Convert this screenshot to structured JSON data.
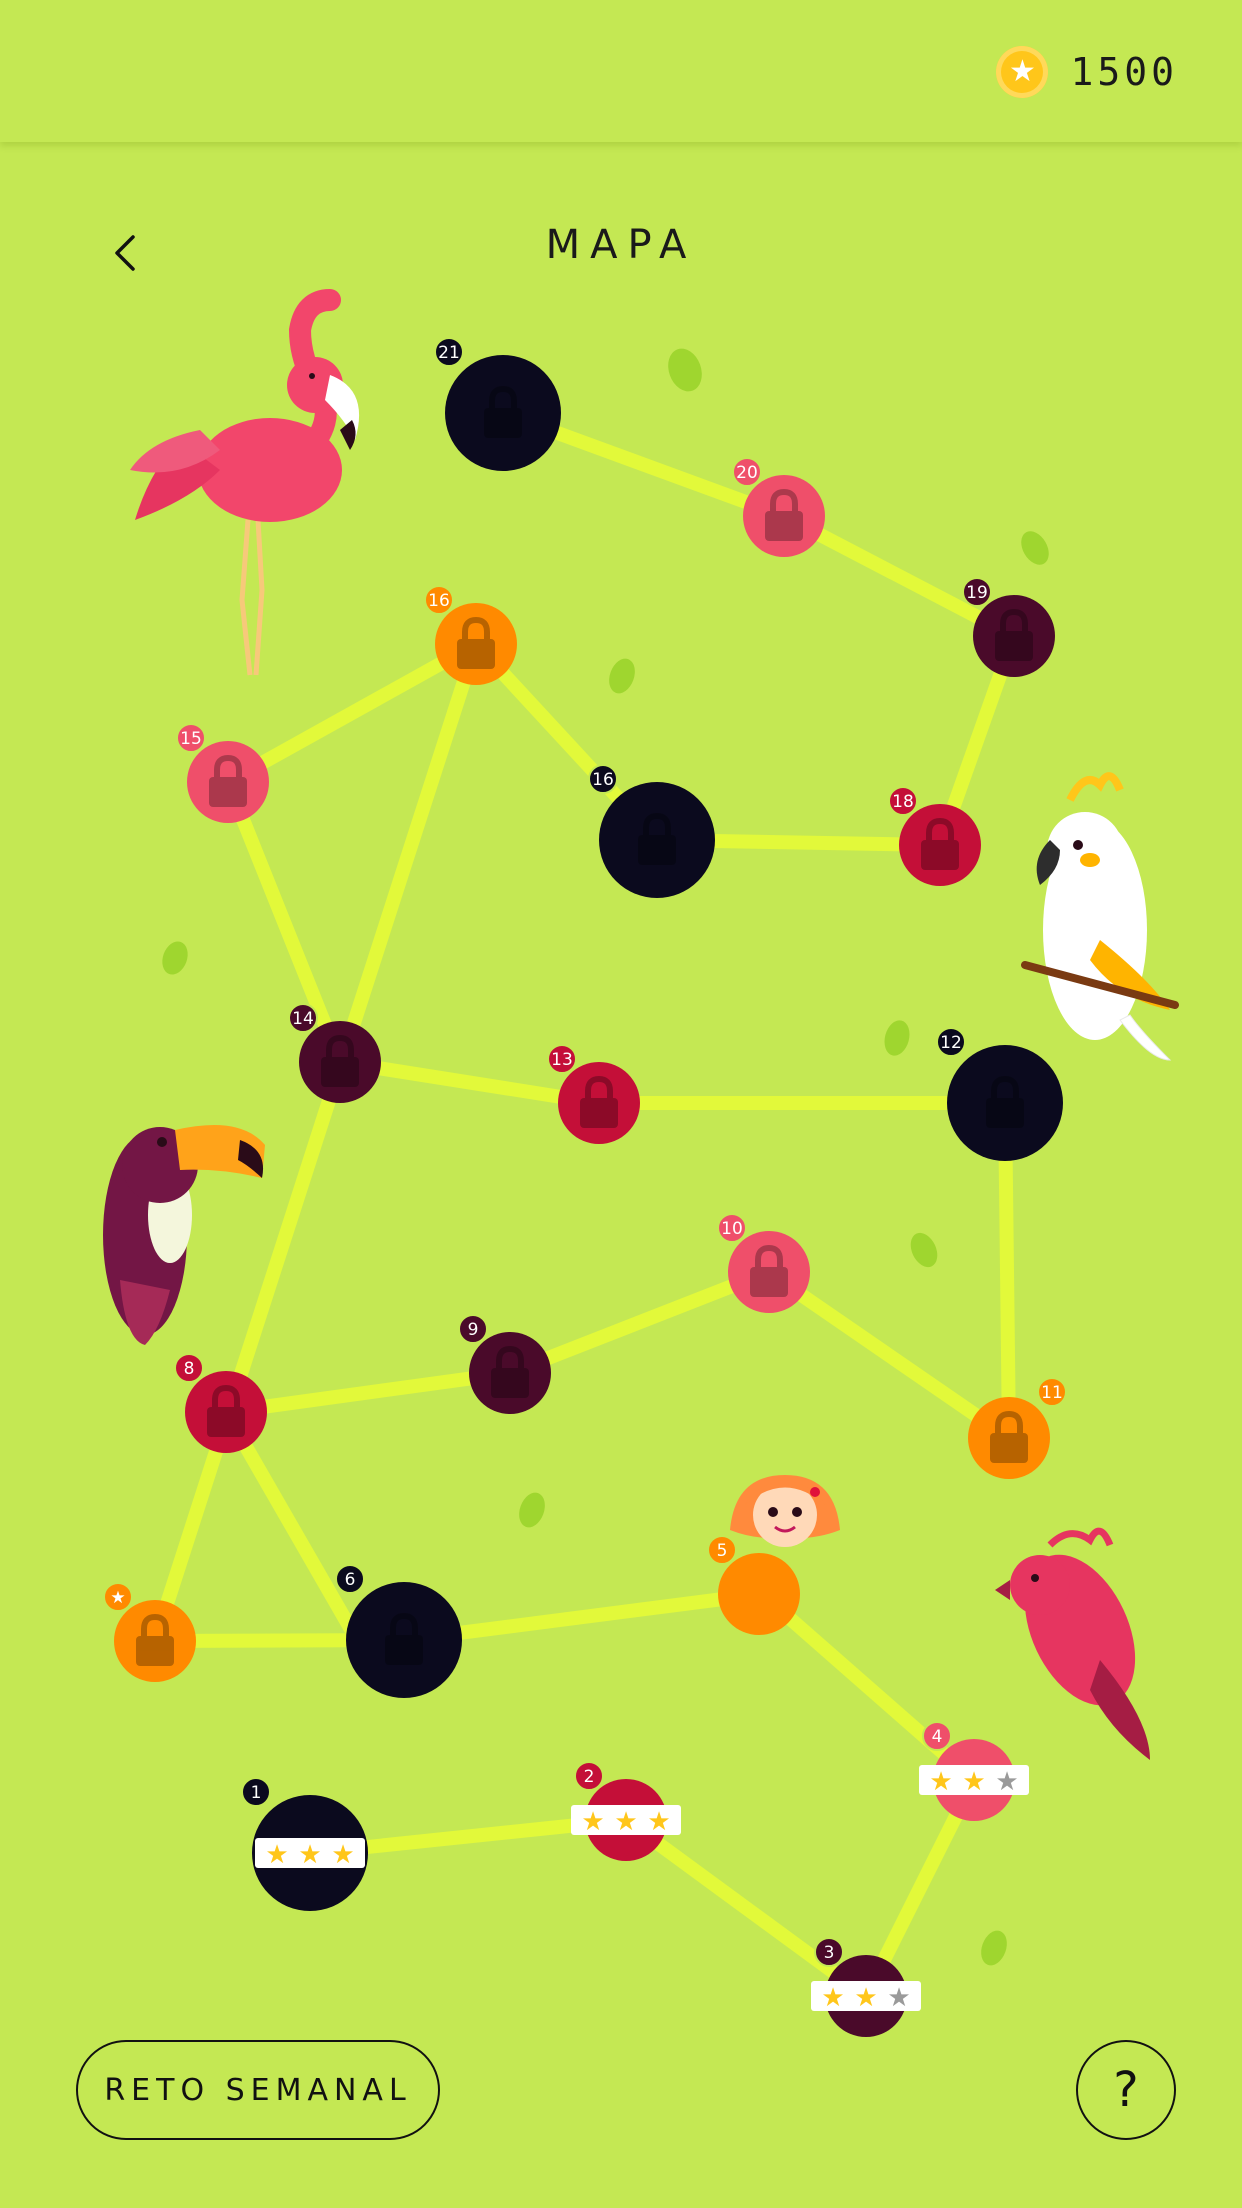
{
  "header": {
    "coins": "1500",
    "coin_icon": "star-coin-icon"
  },
  "page": {
    "title": "MAPA",
    "back_icon": "chevron-left-icon"
  },
  "levels": [
    {
      "label": "21",
      "state": "locked",
      "color": "#0b0a1e",
      "badge_color": "#0b0a1e"
    },
    {
      "label": "20",
      "state": "locked",
      "color": "#ef4f6a",
      "badge_color": "#ef4f6a"
    },
    {
      "label": "19",
      "state": "locked",
      "color": "#4a0a2a",
      "badge_color": "#4a0a2a"
    },
    {
      "label": "16",
      "state": "locked",
      "color": "#ff8a00",
      "badge_color": "#ff8a00"
    },
    {
      "label": "15",
      "state": "locked",
      "color": "#ef4f6a",
      "badge_color": "#ef4f6a"
    },
    {
      "label": "16",
      "state": "locked",
      "color": "#0b0a1e",
      "badge_color": "#0b0a1e"
    },
    {
      "label": "18",
      "state": "locked",
      "color": "#c40f38",
      "badge_color": "#c40f38"
    },
    {
      "label": "14",
      "state": "locked",
      "color": "#4a0a2a",
      "badge_color": "#4a0a2a"
    },
    {
      "label": "13",
      "state": "locked",
      "color": "#c40f38",
      "badge_color": "#c40f38"
    },
    {
      "label": "12",
      "state": "locked",
      "color": "#0b0a1e",
      "badge_color": "#0b0a1e"
    },
    {
      "label": "10",
      "state": "locked",
      "color": "#ef4f6a",
      "badge_color": "#ef4f6a"
    },
    {
      "label": "9",
      "state": "locked",
      "color": "#4a0a2a",
      "badge_color": "#4a0a2a"
    },
    {
      "label": "8",
      "state": "locked",
      "color": "#c40f38",
      "badge_color": "#c40f38"
    },
    {
      "label": "11",
      "state": "locked",
      "color": "#ff8a00",
      "badge_color": "#ff8a00"
    },
    {
      "label": "★",
      "state": "locked",
      "color": "#ff8a00",
      "badge_color": "#ff8a00"
    },
    {
      "label": "6",
      "state": "locked",
      "color": "#0b0a1e",
      "badge_color": "#0b0a1e"
    },
    {
      "label": "5",
      "state": "current",
      "color": "#ff8a00",
      "badge_color": "#ff8a00"
    },
    {
      "label": "4",
      "state": "done",
      "color": "#ef4f6a",
      "badge_color": "#ef4f6a",
      "stars": 2
    },
    {
      "label": "2",
      "state": "done",
      "color": "#c40f38",
      "badge_color": "#c40f38",
      "stars": 3
    },
    {
      "label": "1",
      "state": "done",
      "color": "#0b0a1e",
      "badge_color": "#0b0a1e",
      "stars": 3
    },
    {
      "label": "3",
      "state": "done",
      "color": "#4a0a2a",
      "badge_color": "#4a0a2a",
      "stars": 2
    }
  ],
  "colors": {
    "background": "#c4e853",
    "path": "#e2f93a",
    "star_filled": "#ffc61a",
    "star_empty": "#9a9a9a"
  },
  "decorations": [
    "flamingo",
    "cockatoo",
    "toucan",
    "red-parrot",
    "player-avatar"
  ],
  "footer": {
    "weekly_challenge": "RETO SEMANAL",
    "help": "?"
  }
}
